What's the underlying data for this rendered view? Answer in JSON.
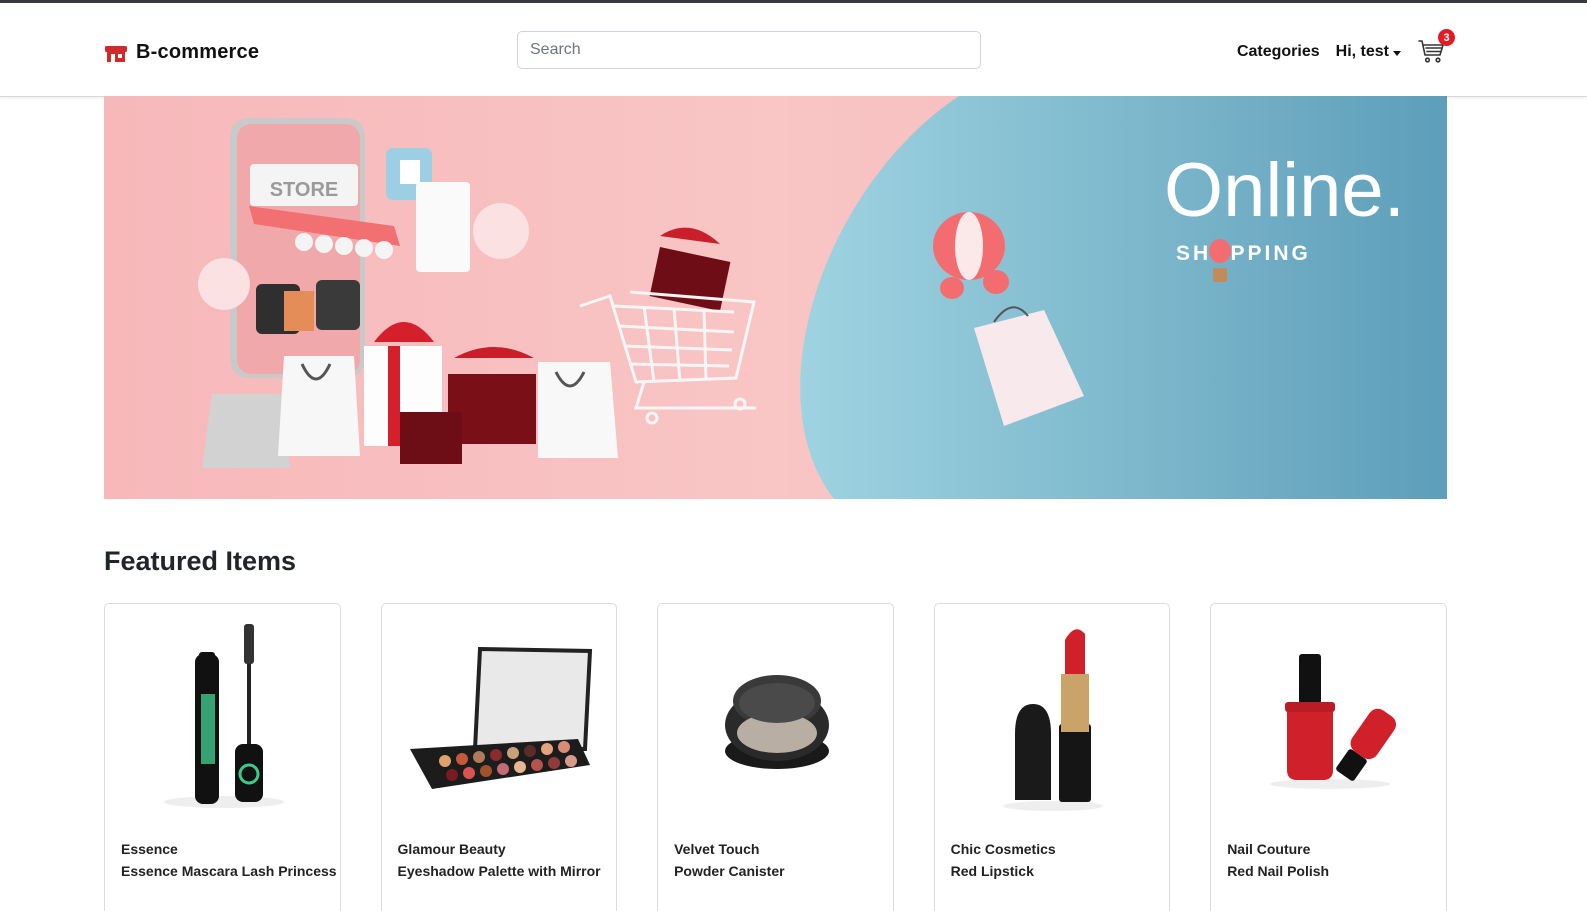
{
  "brand": {
    "name": "B-commerce"
  },
  "search": {
    "placeholder": "Search"
  },
  "nav": {
    "categories": "Categories",
    "user_greeting": "Hi, test",
    "cart_count": "3"
  },
  "banner": {
    "headline": "Online.",
    "subheadline": "SHOPPING",
    "store_sign": "STORE"
  },
  "featured": {
    "title": "Featured Items",
    "items": [
      {
        "brand": "Essence",
        "name": "Essence Mascara Lash Princess",
        "icon": "mascara-image"
      },
      {
        "brand": "Glamour Beauty",
        "name": "Eyeshadow Palette with Mirror",
        "icon": "eyeshadow-palette-image"
      },
      {
        "brand": "Velvet Touch",
        "name": "Powder Canister",
        "icon": "powder-canister-image"
      },
      {
        "brand": "Chic Cosmetics",
        "name": "Red Lipstick",
        "icon": "lipstick-image"
      },
      {
        "brand": "Nail Couture",
        "name": "Red Nail Polish",
        "icon": "nail-polish-image"
      }
    ]
  },
  "colors": {
    "brand_red": "#c8202b",
    "banner_pink": "#f6b8ba",
    "banner_blue": "#6aa9c4",
    "badge_red": "#e01b24"
  }
}
